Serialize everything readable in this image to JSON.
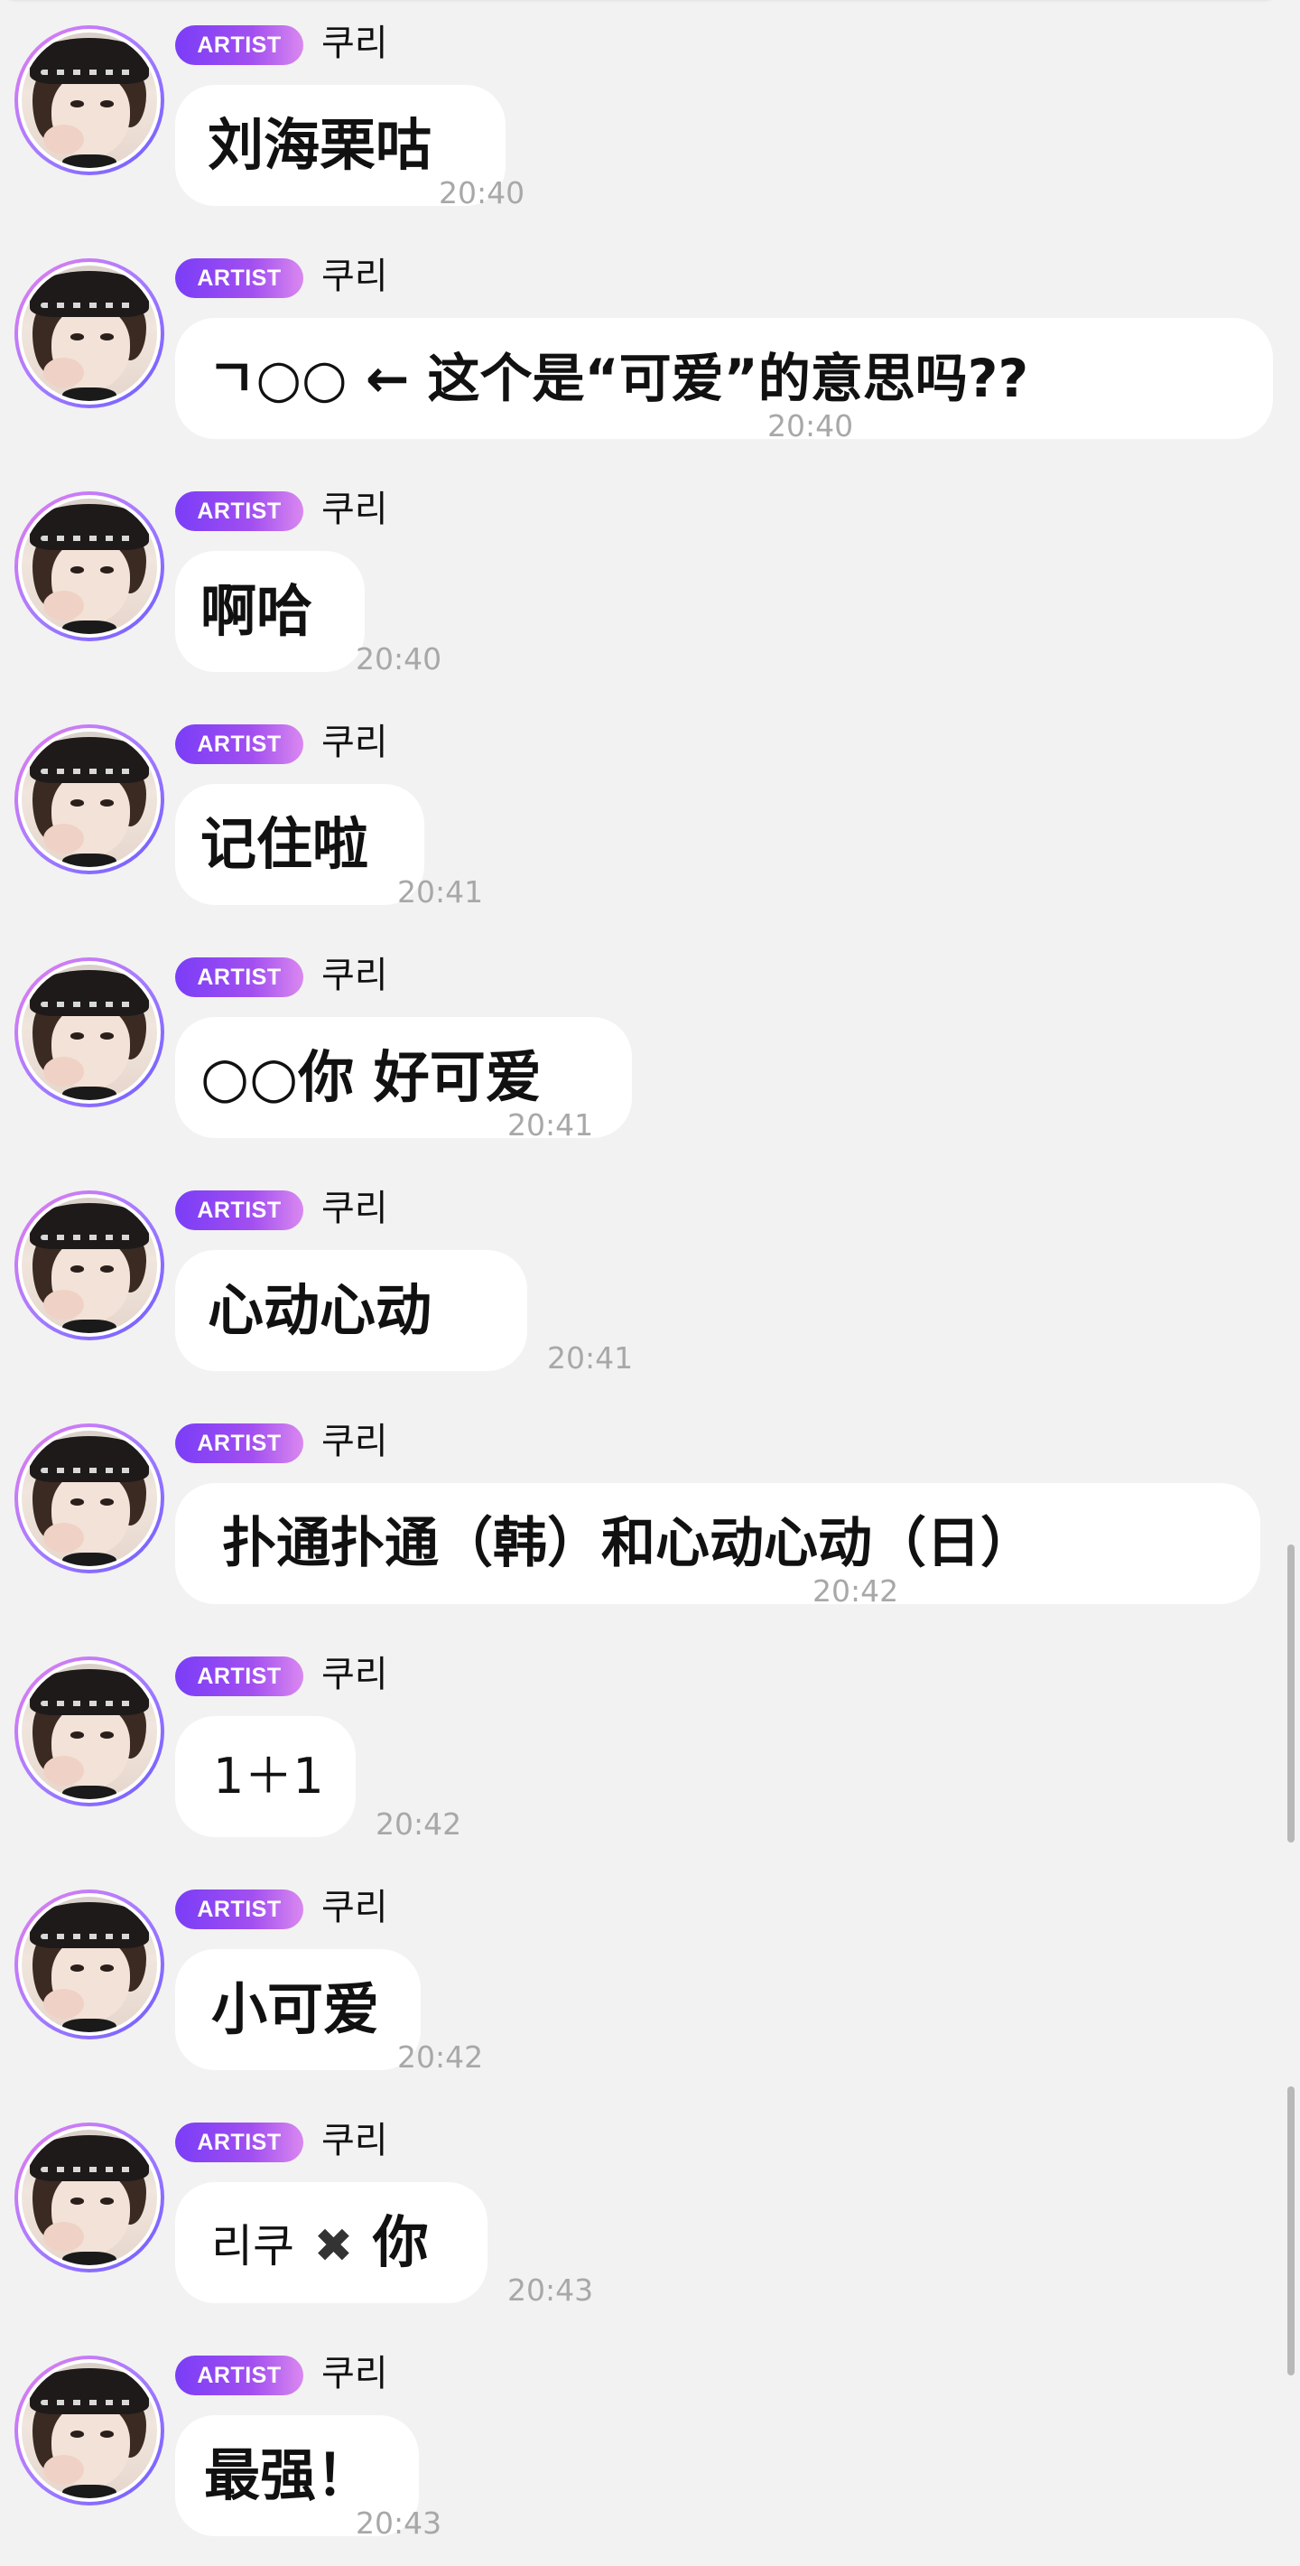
{
  "badge_label": "ARTIST",
  "sender_name": "쿠리",
  "messages": [
    {
      "text": "刘海栗咕",
      "time": "20:40"
    },
    {
      "text": "ㄱ○○ ← 这个是“可爱”的意思吗??",
      "time": "20:40"
    },
    {
      "text": "啊哈",
      "time": "20:40"
    },
    {
      "text": "记住啦",
      "time": "20:41"
    },
    {
      "text": "○○你 好可爱",
      "time": "20:41"
    },
    {
      "text": "心动心动",
      "time": "20:41"
    },
    {
      "text": "扑通扑通（韩）和心动心动（日）",
      "time": "20:42"
    },
    {
      "text": "1＋1",
      "time": "20:42"
    },
    {
      "text": "小可爱",
      "time": "20:42"
    },
    {
      "text_a": "리쿠",
      "text_mark": "✖",
      "text_b": "你",
      "time": "20:43"
    },
    {
      "text": "最强！",
      "time": "20:43"
    }
  ],
  "colors": {
    "background": "#f2f2f2",
    "bubble": "#ffffff",
    "badge_start": "#7a3df7",
    "badge_end": "#d988f0",
    "timestamp": "#a8a8a8"
  }
}
